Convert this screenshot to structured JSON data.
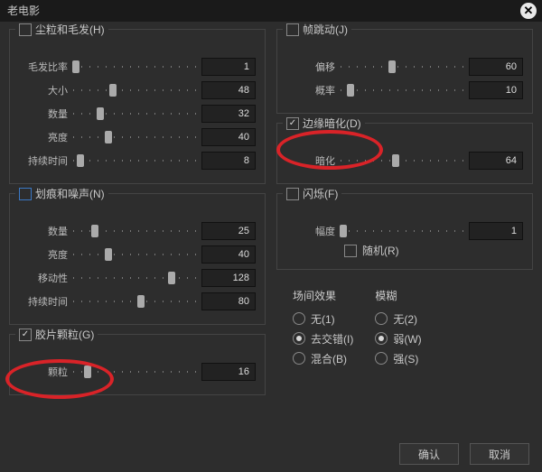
{
  "dialog_title": "老电影",
  "sections": {
    "dust_hair": {
      "title": "尘粒和毛发(H)",
      "checked": false,
      "sliders": [
        {
          "label": "毛发比率",
          "value": 1,
          "pct": 2
        },
        {
          "label": "大小",
          "value": 48,
          "pct": 32
        },
        {
          "label": "数量",
          "value": 32,
          "pct": 22
        },
        {
          "label": "亮度",
          "value": 40,
          "pct": 29
        },
        {
          "label": "持续时间",
          "value": 8,
          "pct": 6
        }
      ]
    },
    "scratch_noise": {
      "title": "划痕和噪声(N)",
      "checked": false,
      "sliders": [
        {
          "label": "数量",
          "value": 25,
          "pct": 18
        },
        {
          "label": "亮度",
          "value": 40,
          "pct": 29
        },
        {
          "label": "移动性",
          "value": 128,
          "pct": 80
        },
        {
          "label": "持续时间",
          "value": 80,
          "pct": 55
        }
      ]
    },
    "film_grain": {
      "title": "胶片颗粒(G)",
      "checked": true,
      "sliders": [
        {
          "label": "颗粒",
          "value": 16,
          "pct": 12
        }
      ]
    },
    "frame_jitter": {
      "title": "帧跳动(J)",
      "checked": false,
      "sliders": [
        {
          "label": "偏移",
          "value": 60,
          "pct": 42
        },
        {
          "label": "概率",
          "value": 10,
          "pct": 8
        }
      ]
    },
    "vignette": {
      "title": "边缘暗化(D)",
      "checked": true,
      "sliders": [
        {
          "label": "暗化",
          "value": 64,
          "pct": 45
        }
      ]
    },
    "flicker": {
      "title": "闪烁(F)",
      "checked": false,
      "sliders": [
        {
          "label": "幅度",
          "value": 1,
          "pct": 2
        }
      ],
      "random_label": "随机(R)",
      "random_checked": false
    },
    "radios": {
      "field_label": "场间效果",
      "field_options": [
        {
          "label": "无(1)",
          "selected": false
        },
        {
          "label": "去交错(I)",
          "selected": true
        },
        {
          "label": "混合(B)",
          "selected": false
        }
      ],
      "blur_label": "模糊",
      "blur_options": [
        {
          "label": "无(2)",
          "selected": false
        },
        {
          "label": "弱(W)",
          "selected": true
        },
        {
          "label": "强(S)",
          "selected": false
        }
      ]
    }
  },
  "buttons": {
    "ok": "确认",
    "cancel": "取消"
  }
}
